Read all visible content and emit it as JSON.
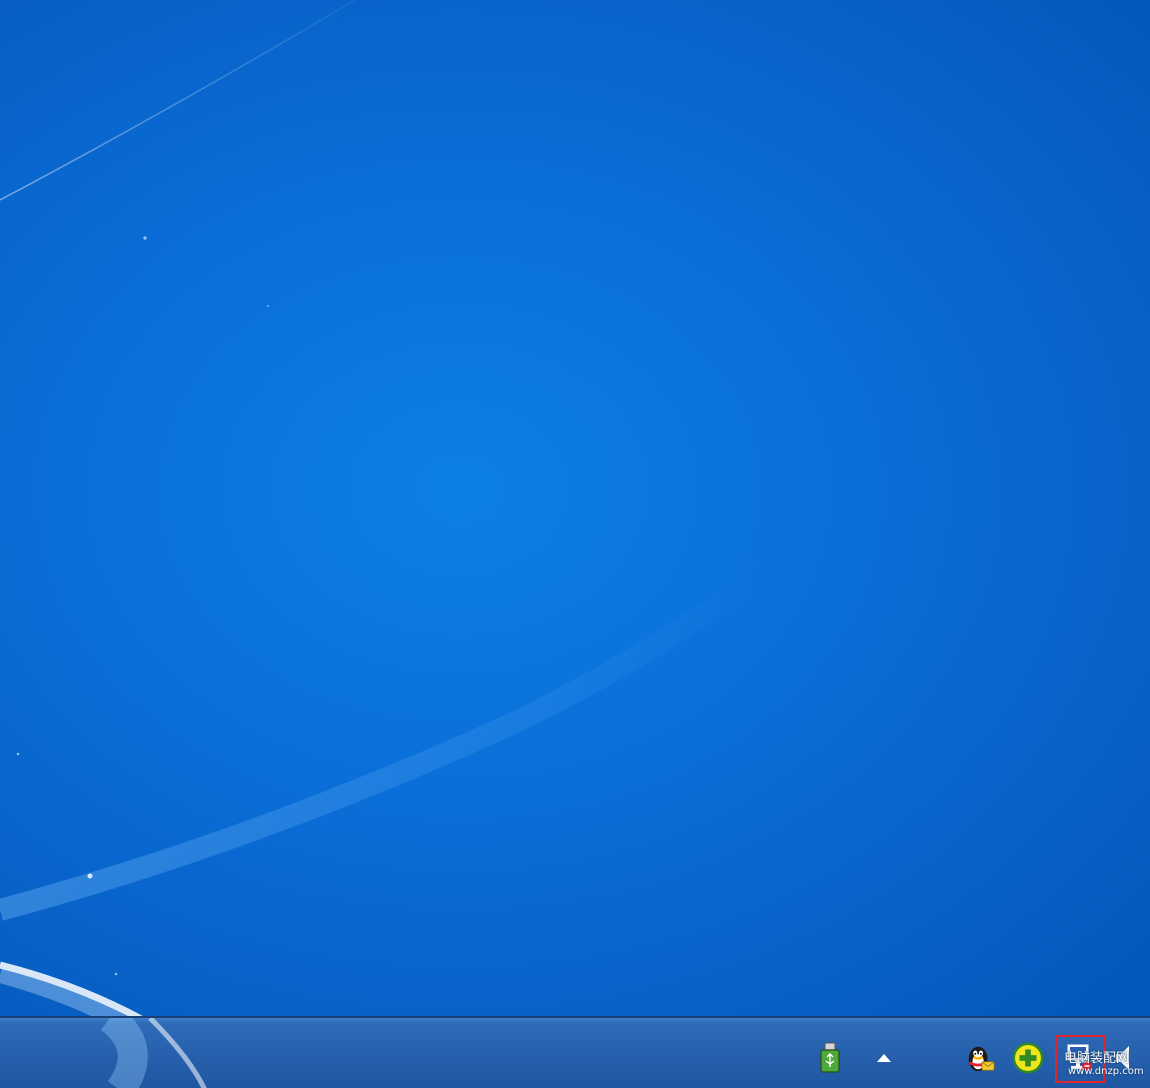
{
  "desktop": {
    "background_color": "#0a6ed8"
  },
  "taskbar": {
    "color": "#2761ad",
    "tray": {
      "icons": [
        "usb-device-icon",
        "show-hidden-icons-arrow",
        "qq-icon",
        "360-security-icon",
        "network-icon",
        "volume-icon"
      ],
      "highlight_color": "#e3242b"
    }
  },
  "watermark": {
    "text": "电脑装配网",
    "url": "www.dnzp.com"
  }
}
